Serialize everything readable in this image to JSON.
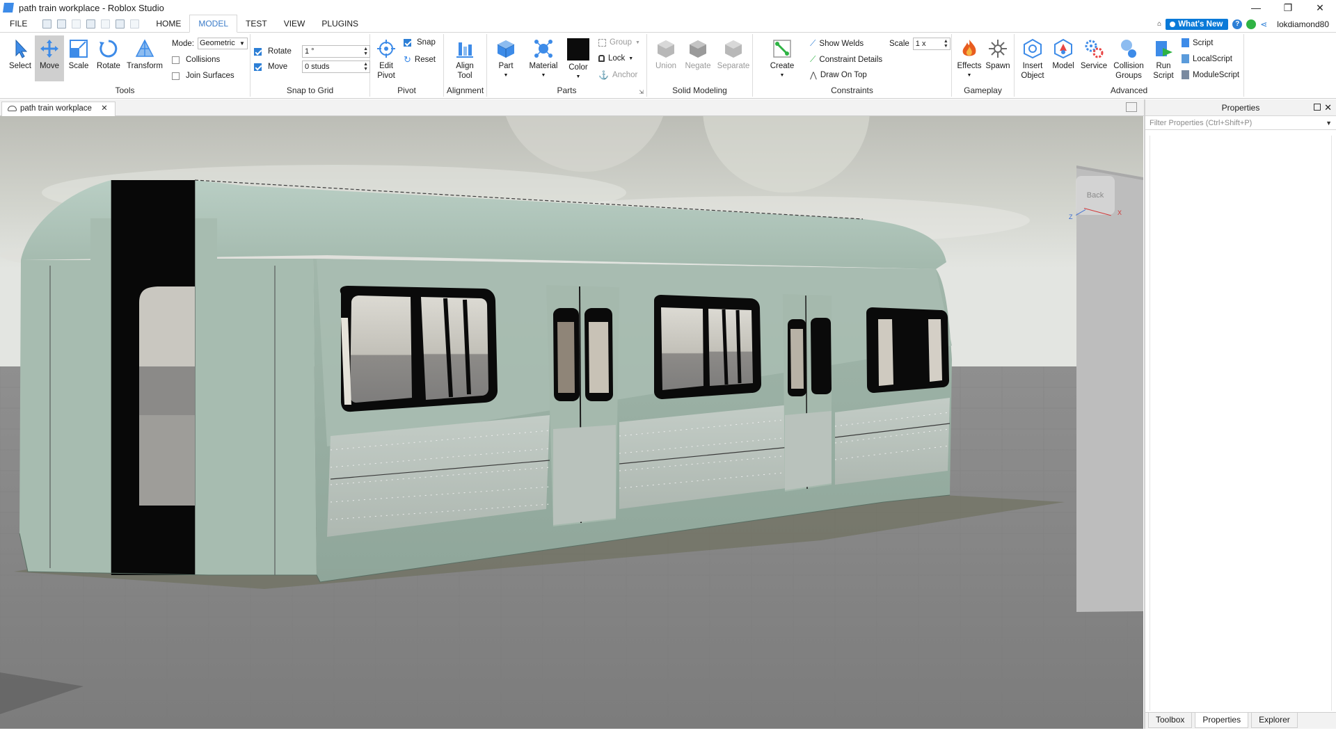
{
  "window": {
    "title": "path train workplace - Roblox Studio",
    "minimize": "—",
    "maximize": "❐",
    "close": "✕"
  },
  "menu": {
    "file": "FILE",
    "tabs": [
      "HOME",
      "MODEL",
      "TEST",
      "VIEW",
      "PLUGINS"
    ],
    "active_tab": "MODEL",
    "whats_new": "What's New",
    "username": "lokdiamond80"
  },
  "ribbon": {
    "tools": {
      "select": "Select",
      "move": "Move",
      "scale": "Scale",
      "rotate": "Rotate",
      "transform": "Transform",
      "mode_label": "Mode:",
      "mode_value": "Geometric",
      "collisions": "Collisions",
      "join_surfaces": "Join Surfaces",
      "label": "Tools"
    },
    "snap": {
      "rotate": "Rotate",
      "rotate_value": "1 °",
      "move": "Move",
      "move_value": "0 studs",
      "label": "Snap to Grid"
    },
    "pivot": {
      "edit_pivot_1": "Edit",
      "edit_pivot_2": "Pivot",
      "snap": "Snap",
      "reset": "Reset",
      "label": "Pivot"
    },
    "alignment": {
      "align_1": "Align",
      "align_2": "Tool",
      "label": "Alignment"
    },
    "parts": {
      "part": "Part",
      "material": "Material",
      "color": "Color",
      "group": "Group",
      "lock": "Lock",
      "anchor": "Anchor",
      "label": "Parts"
    },
    "solid": {
      "union": "Union",
      "negate": "Negate",
      "separate": "Separate",
      "label": "Solid Modeling"
    },
    "constraints": {
      "create": "Create",
      "show_welds": "Show Welds",
      "constraint_details": "Constraint Details",
      "draw_on_top": "Draw On Top",
      "scale_label": "Scale",
      "scale_value": "1 x",
      "label": "Constraints"
    },
    "gameplay": {
      "effects": "Effects",
      "spawn": "Spawn",
      "label": "Gameplay"
    },
    "advanced": {
      "insert_1": "Insert",
      "insert_2": "Object",
      "model": "Model",
      "service": "Service",
      "collision_1": "Collision",
      "collision_2": "Groups",
      "run_1": "Run",
      "run_2": "Script",
      "script": "Script",
      "local_script": "LocalScript",
      "module_script": "ModuleScript",
      "label": "Advanced"
    }
  },
  "document_tab": {
    "name": "path train workplace",
    "close": "✕"
  },
  "viewport": {
    "view_cube_label": "Back",
    "axis_x": "X",
    "axis_z": "Z"
  },
  "properties": {
    "title": "Properties",
    "filter_placeholder": "Filter Properties (Ctrl+Shift+P)",
    "close": "✕"
  },
  "bottom_tabs": [
    "Toolbox",
    "Properties",
    "Explorer"
  ],
  "colors": {
    "accent": "#3a7bc8",
    "whats_new": "#0a7ad8",
    "train_body": "#9fb5a8",
    "sky": "#c6cac6",
    "floor": "#8a8a8a"
  }
}
